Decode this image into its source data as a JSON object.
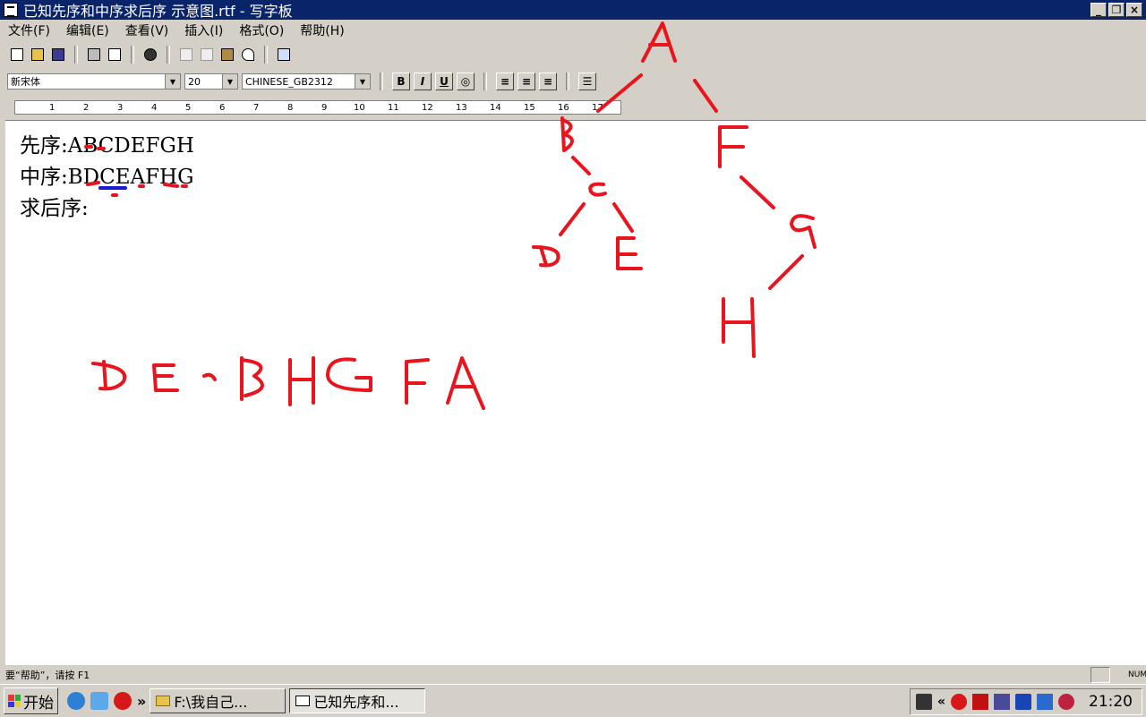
{
  "window": {
    "title": "已知先序和中序求后序 示意图.rtf - 写字板",
    "buttons": [
      "_",
      "❐",
      "×"
    ]
  },
  "menu": [
    "文件(F)",
    "编辑(E)",
    "查看(V)",
    "插入(I)",
    "格式(O)",
    "帮助(H)"
  ],
  "toolbar": {
    "icons": [
      "new-document-icon",
      "open-folder-icon",
      "save-icon",
      "print-icon",
      "print-preview-icon",
      "find-icon",
      "cut-icon",
      "copy-icon",
      "paste-icon",
      "undo-icon",
      "insert-datetime-icon"
    ]
  },
  "format": {
    "font_name": "新宋体",
    "font_size": "20",
    "script": "CHINESE_GB2312",
    "bold": "B",
    "italic": "I",
    "underline": "U"
  },
  "ruler": {
    "marks": [
      "1",
      "2",
      "3",
      "4",
      "5",
      "6",
      "7",
      "8",
      "9",
      "10",
      "11",
      "12",
      "13",
      "14",
      "15",
      "16",
      "17"
    ]
  },
  "document": {
    "lines": [
      "先序:ABCDEFGH",
      "中序:BDCEAFHG",
      "求后序:"
    ]
  },
  "handwriting": {
    "tree_nodes": [
      "A",
      "B",
      "F",
      "C",
      "G",
      "D",
      "E",
      "H"
    ],
    "answer": "DECBHGFA",
    "ink_color": "#e8141e"
  },
  "statusbar": {
    "help_text": "要“帮助”，请按 F1",
    "indicator": "NUM"
  },
  "taskbar": {
    "start_label": "开始",
    "tasks": [
      "F:\\我自己...",
      "已知先序和..."
    ],
    "chevron": "»",
    "tray_chevron": "«",
    "clock": "21:20"
  }
}
